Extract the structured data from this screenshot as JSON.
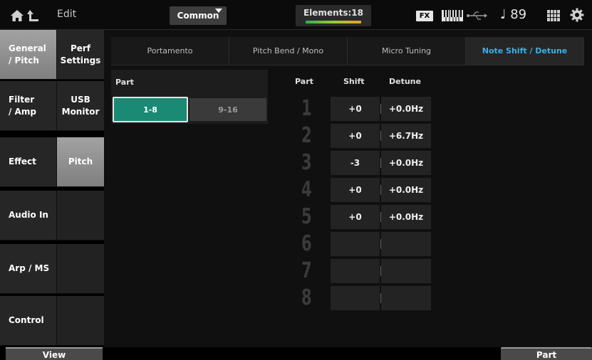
{
  "topbar": {
    "edit_label": "Edit",
    "common_label": "Common",
    "elements_label": "Elements:18",
    "fx_label": "FX",
    "tempo": "♩ 89"
  },
  "left_tabs": [
    {
      "label": "General\n/ Pitch",
      "active": true
    },
    {
      "label": "Filter\n/ Amp",
      "active": false
    },
    {
      "label": "Effect",
      "active": false
    },
    {
      "label": "Audio In",
      "active": false
    },
    {
      "label": "Arp / MS",
      "active": false
    },
    {
      "label": "Control",
      "active": false
    }
  ],
  "sub_tabs": [
    {
      "label": "Perf\nSettings",
      "active": false
    },
    {
      "label": "USB\nMonitor",
      "active": false
    },
    {
      "label": "Pitch",
      "active": true
    }
  ],
  "view_label": "View",
  "tabs": [
    {
      "label": "Portamento",
      "active": false
    },
    {
      "label": "Pitch Bend / Mono",
      "active": false
    },
    {
      "label": "Micro Tuning",
      "active": false
    },
    {
      "label": "Note Shift / Detune",
      "active": true
    }
  ],
  "part_selector": {
    "label": "Part",
    "options": [
      "1-8",
      "9-16"
    ],
    "selected": "1-8"
  },
  "table": {
    "headers": {
      "part": "Part",
      "shift": "Shift",
      "detune": "Detune"
    },
    "rows": [
      {
        "part": "1",
        "shift": "+0",
        "detune": "+0.0Hz"
      },
      {
        "part": "2",
        "shift": "+0",
        "detune": "+6.7Hz"
      },
      {
        "part": "3",
        "shift": "-3",
        "detune": "+0.0Hz"
      },
      {
        "part": "4",
        "shift": "+0",
        "detune": "+0.0Hz"
      },
      {
        "part": "5",
        "shift": "+0",
        "detune": "+0.0Hz"
      },
      {
        "part": "6",
        "shift": "",
        "detune": ""
      },
      {
        "part": "7",
        "shift": "",
        "detune": ""
      },
      {
        "part": "8",
        "shift": "",
        "detune": ""
      }
    ]
  },
  "bottom_part_label": "Part",
  "colors": {
    "accent_blue": "#39b1e6",
    "selected_teal": "#1a8a74"
  }
}
